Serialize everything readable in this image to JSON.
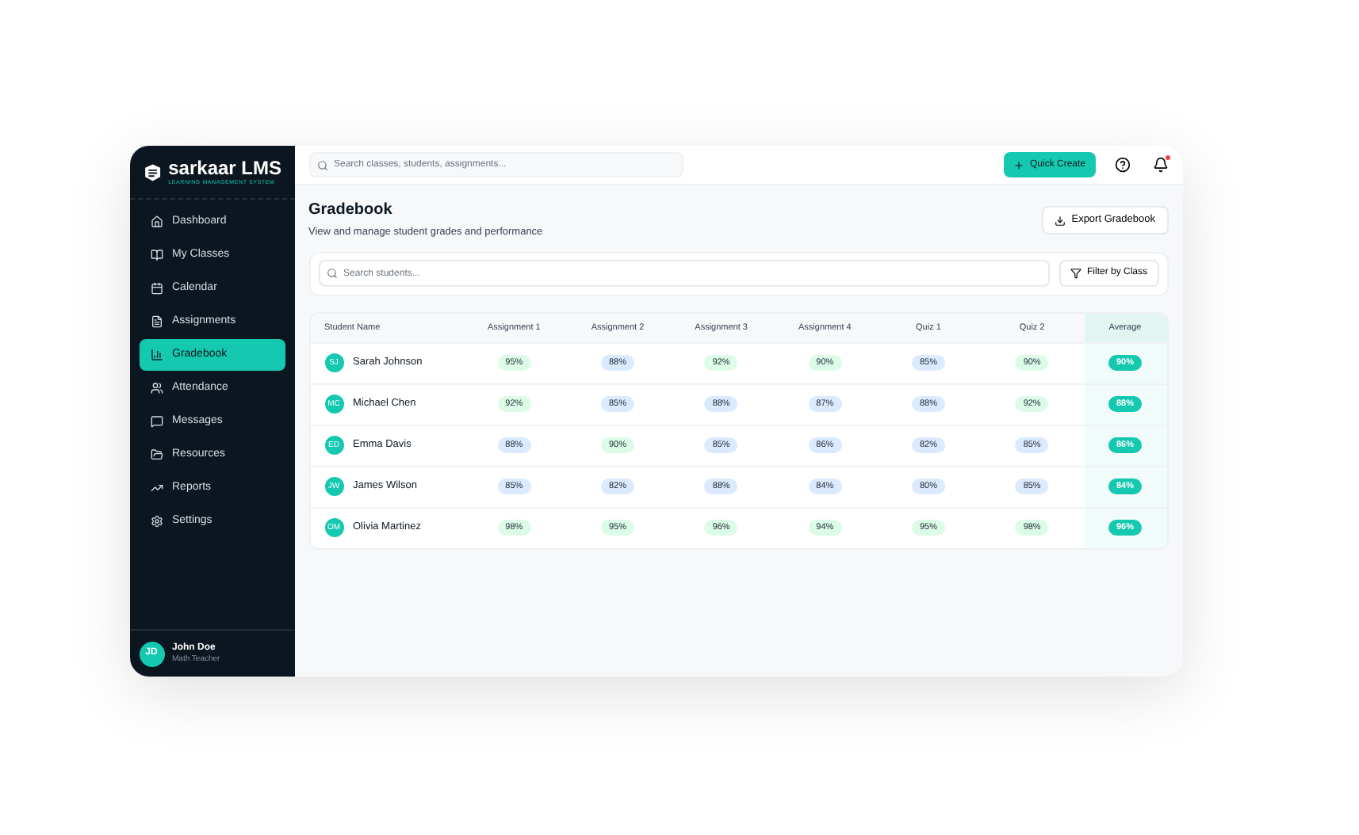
{
  "brand": {
    "name": "sarkaar LMS",
    "tagline": "LEARNING MANAGEMENT SYSTEM"
  },
  "sidebar": {
    "items": [
      {
        "label": "Dashboard",
        "selected": false
      },
      {
        "label": "My Classes",
        "selected": false
      },
      {
        "label": "Calendar",
        "selected": false
      },
      {
        "label": "Assignments",
        "selected": false
      },
      {
        "label": "Gradebook",
        "selected": true
      },
      {
        "label": "Attendance",
        "selected": false
      },
      {
        "label": "Messages",
        "selected": false
      },
      {
        "label": "Resources",
        "selected": false
      },
      {
        "label": "Reports",
        "selected": false
      },
      {
        "label": "Settings",
        "selected": false
      }
    ],
    "user": {
      "initials": "JD",
      "name": "John Doe",
      "role": "Math Teacher"
    }
  },
  "topbar": {
    "search": {
      "placeholder": "Search classes, students, assignments..."
    },
    "quick_create": "Quick Create",
    "notification_unread": true
  },
  "page": {
    "title": "Gradebook",
    "subtitle": "View and manage student grades and performance",
    "export_button": "Export Gradebook"
  },
  "filters": {
    "search": {
      "placeholder": "Search students..."
    },
    "filter_button": "Filter by Class"
  },
  "table": {
    "columns": [
      "Student Name",
      "Assignment 1",
      "Assignment 2",
      "Assignment 3",
      "Assignment 4",
      "Quiz 1",
      "Quiz 2",
      "Average"
    ],
    "rows": [
      {
        "initials": "SJ",
        "name": "Sarah Johnson",
        "grades": [
          {
            "text": "95%",
            "color": "#dcfce7"
          },
          {
            "text": "88%",
            "color": "#dbeafe"
          },
          {
            "text": "92%",
            "color": "#dcfce7"
          },
          {
            "text": "90%",
            "color": "#dcfce7"
          },
          {
            "text": "85%",
            "color": "#dbeafe"
          },
          {
            "text": "90%",
            "color": "#dcfce7"
          }
        ],
        "average": "90%"
      },
      {
        "initials": "MC",
        "name": "Michael Chen",
        "grades": [
          {
            "text": "92%",
            "color": "#dcfce7"
          },
          {
            "text": "85%",
            "color": "#dbeafe"
          },
          {
            "text": "88%",
            "color": "#dbeafe"
          },
          {
            "text": "87%",
            "color": "#dbeafe"
          },
          {
            "text": "88%",
            "color": "#dbeafe"
          },
          {
            "text": "92%",
            "color": "#dcfce7"
          }
        ],
        "average": "88%"
      },
      {
        "initials": "ED",
        "name": "Emma Davis",
        "grades": [
          {
            "text": "88%",
            "color": "#dbeafe"
          },
          {
            "text": "90%",
            "color": "#dcfce7"
          },
          {
            "text": "85%",
            "color": "#dbeafe"
          },
          {
            "text": "86%",
            "color": "#dbeafe"
          },
          {
            "text": "82%",
            "color": "#dbeafe"
          },
          {
            "text": "85%",
            "color": "#dbeafe"
          }
        ],
        "average": "86%"
      },
      {
        "initials": "JW",
        "name": "James Wilson",
        "grades": [
          {
            "text": "85%",
            "color": "#dbeafe"
          },
          {
            "text": "82%",
            "color": "#dbeafe"
          },
          {
            "text": "88%",
            "color": "#dbeafe"
          },
          {
            "text": "84%",
            "color": "#dbeafe"
          },
          {
            "text": "80%",
            "color": "#dbeafe"
          },
          {
            "text": "85%",
            "color": "#dbeafe"
          }
        ],
        "average": "84%"
      },
      {
        "initials": "OM",
        "name": "Olivia Martinez",
        "grades": [
          {
            "text": "98%",
            "color": "#dcfce7"
          },
          {
            "text": "95%",
            "color": "#dcfce7"
          },
          {
            "text": "96%",
            "color": "#dcfce7"
          },
          {
            "text": "94%",
            "color": "#dcfce7"
          },
          {
            "text": "95%",
            "color": "#dcfce7"
          },
          {
            "text": "98%",
            "color": "#dcfce7"
          }
        ],
        "average": "96%"
      }
    ]
  }
}
